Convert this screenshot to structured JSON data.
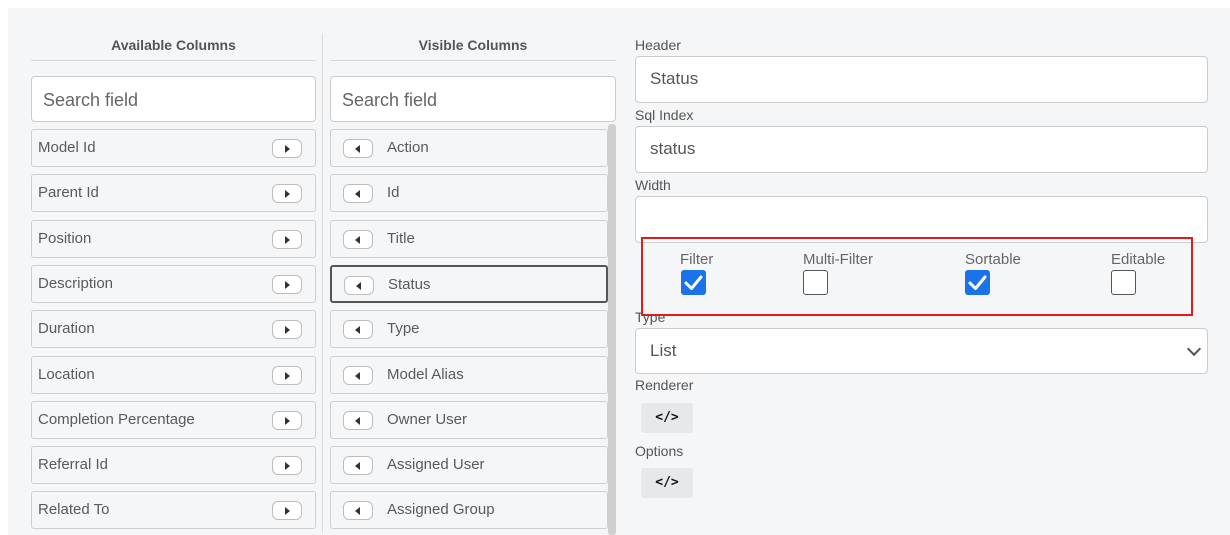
{
  "available": {
    "header": "Available Columns",
    "search_placeholder": "Search field",
    "items": [
      {
        "label": "Model Id"
      },
      {
        "label": "Parent Id"
      },
      {
        "label": "Position"
      },
      {
        "label": "Description"
      },
      {
        "label": "Duration"
      },
      {
        "label": "Location"
      },
      {
        "label": "Completion Percentage"
      },
      {
        "label": "Referral Id"
      },
      {
        "label": "Related To"
      }
    ]
  },
  "visible": {
    "header": "Visible Columns",
    "search_placeholder": "Search field",
    "selected": "Status",
    "items": [
      {
        "label": "Action"
      },
      {
        "label": "Id"
      },
      {
        "label": "Title"
      },
      {
        "label": "Status"
      },
      {
        "label": "Type"
      },
      {
        "label": "Model Alias"
      },
      {
        "label": "Owner User"
      },
      {
        "label": "Assigned User"
      },
      {
        "label": "Assigned Group"
      }
    ]
  },
  "props": {
    "header_label": "Header",
    "header_value": "Status",
    "sql_index_label": "Sql Index",
    "sql_index_value": "status",
    "width_label": "Width",
    "width_value": "",
    "checkboxes": [
      {
        "label": "Filter",
        "checked": true
      },
      {
        "label": "Multi-Filter",
        "checked": false
      },
      {
        "label": "Sortable",
        "checked": true
      },
      {
        "label": "Editable",
        "checked": false
      }
    ],
    "type_label": "Type",
    "type_value": "List",
    "renderer_label": "Renderer",
    "options_label": "Options",
    "code_glyph": "</>"
  },
  "colors": {
    "accent": "#1a73e8",
    "highlight_box": "#e21b1b"
  }
}
